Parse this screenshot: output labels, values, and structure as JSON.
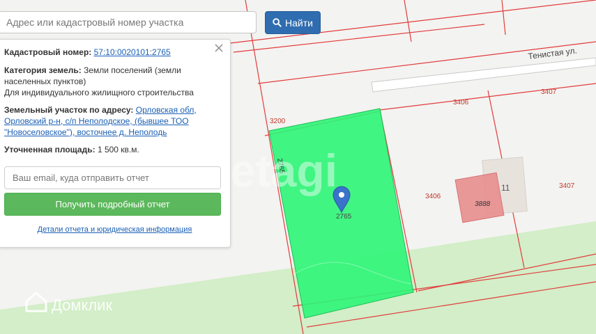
{
  "search": {
    "placeholder": "Адрес или кадастровый номер участка",
    "button_label": "Найти",
    "button_icon": "search-icon"
  },
  "info_panel": {
    "close_icon": "close-icon",
    "cadastral_label": "Кадастровый номер:",
    "cadastral_value": "57:10:0020101:2765",
    "category_label": "Категория земель:",
    "category_value": "Земли поселений (земли населенных пунктов)",
    "permitted_use": "Для индивидуального жилищного строительства",
    "address_label": "Земельный участок по адресу:",
    "address_value": "Орловская обл, Орловский р-н, с/п Неполодское, (бывшее ТОО \"Новоселовское\"), восточнее д. Неполодь",
    "area_label": "Уточненная площадь:",
    "area_value": "1 500 кв.м.",
    "email_placeholder": "Ваш email, куда отправить отчет",
    "report_button": "Получить подробный отчет",
    "details_link": "Детали отчета и юридическая информация"
  },
  "map": {
    "street_name": "Тенистая ул.",
    "parcel_labels": [
      "3200",
      "3406",
      "3407",
      "3406",
      "3407"
    ],
    "selected_parcel_number": "2765",
    "selected_parcel_edge_label": "2765",
    "building_number": "3888",
    "house_number": "11",
    "marker_icon": "map-pin-icon",
    "watermark": "etagi",
    "brand_logo_text": "Домклик",
    "colors": {
      "selected_parcel": "#2ef577",
      "parcel_border": "#e23b3b",
      "building": "#e88e8e",
      "marker": "#3a73c9",
      "green_area": "#d3eec8"
    }
  }
}
